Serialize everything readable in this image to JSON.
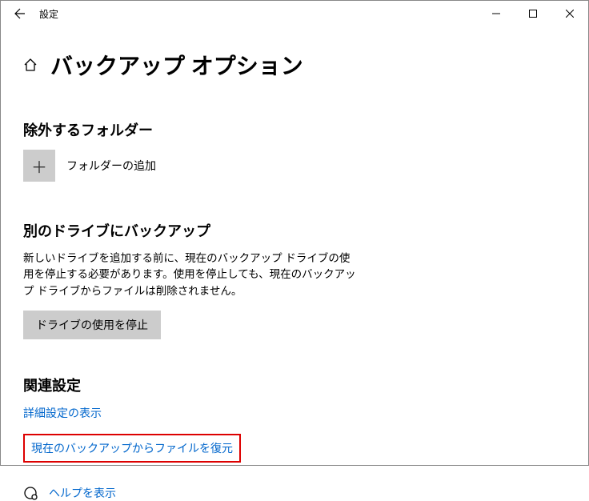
{
  "window": {
    "title": "設定"
  },
  "page": {
    "title": "バックアップ オプション"
  },
  "exclude": {
    "heading": "除外するフォルダー",
    "add_label": "フォルダーの追加"
  },
  "other_drive": {
    "heading": "別のドライブにバックアップ",
    "description": "新しいドライブを追加する前に、現在のバックアップ ドライブの使用を停止する必要があります。使用を停止しても、現在のバックアップ ドライブからファイルは削除されません。",
    "button": "ドライブの使用を停止"
  },
  "related": {
    "heading": "関連設定",
    "advanced_link": "詳細設定の表示",
    "restore_link": "現在のバックアップからファイルを復元"
  },
  "help": {
    "label": "ヘルプを表示"
  }
}
